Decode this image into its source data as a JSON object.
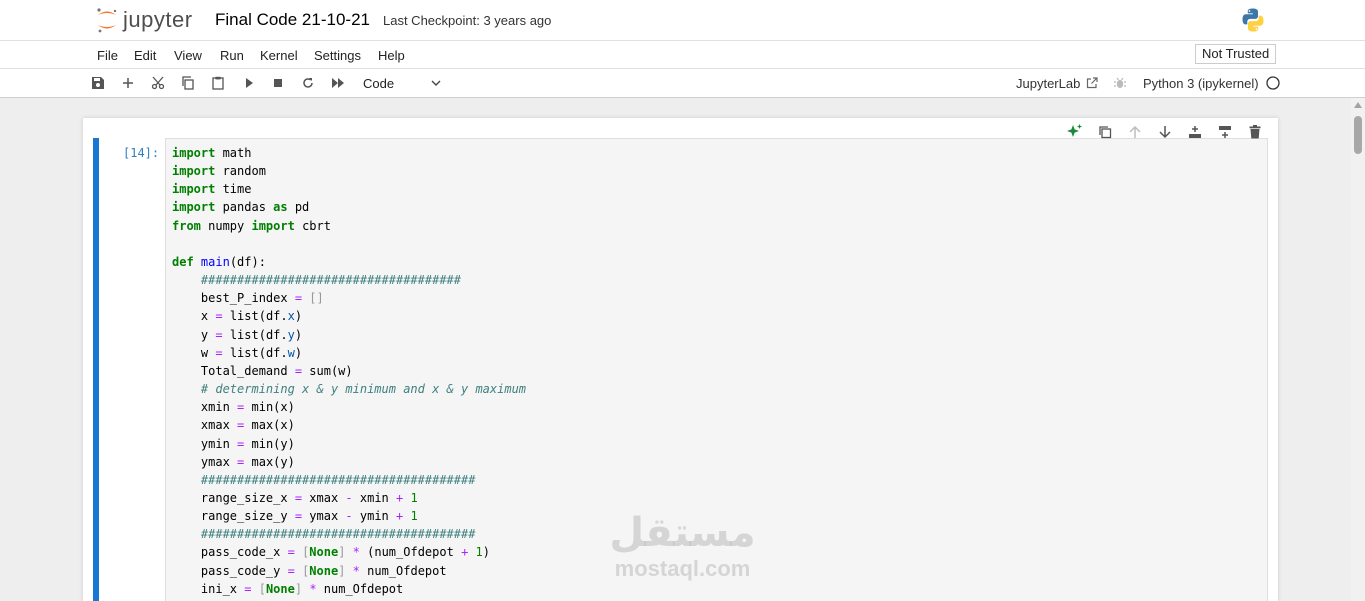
{
  "header": {
    "logo_text": "jupyter",
    "notebook_title": "Final Code 21-10-21",
    "checkpoint_text": "Last Checkpoint: 3 years ago"
  },
  "menubar": {
    "items": [
      "File",
      "Edit",
      "View",
      "Run",
      "Kernel",
      "Settings",
      "Help"
    ],
    "trusted_label": "Not Trusted"
  },
  "toolbar": {
    "icons": [
      "save-icon",
      "add-icon",
      "cut-icon",
      "copy-icon",
      "paste-icon",
      "run-icon",
      "stop-icon",
      "restart-icon",
      "fast-forward-icon"
    ],
    "cell_type": "Code",
    "jupyterlab_label": "JupyterLab",
    "kernel_name": "Python 3 (ipykernel)"
  },
  "cell": {
    "prompt": "[14]:",
    "action_icons": [
      "sparkle-icon",
      "duplicate-icon",
      "move-up-icon",
      "move-down-icon",
      "insert-above-icon",
      "insert-below-icon",
      "delete-icon"
    ],
    "code_lines": [
      "import math",
      "import random",
      "import time",
      "import pandas as pd",
      "from numpy import cbrt",
      "",
      "def main(df):",
      "    ####################################",
      "    best_P_index = []",
      "    x = list(df.x)",
      "    y = list(df.y)",
      "    w = list(df.w)",
      "    Total_demand = sum(w)",
      "    # determining x & y minimum and x & y maximum",
      "    xmin = min(x)",
      "    xmax = max(x)",
      "    ymin = min(y)",
      "    ymax = max(y)",
      "    ######################################",
      "    range_size_x = xmax - xmin + 1",
      "    range_size_y = ymax - ymin + 1",
      "    ######################################",
      "    pass_code_x = [None] * (num_Ofdepot + 1)",
      "    pass_code_y = [None] * num_Ofdepot",
      "    ini_x = [None] * num_Ofdepot"
    ]
  },
  "watermark": {
    "arabic": "مستقل",
    "latin": "mostaql.com"
  },
  "colors": {
    "cell_bar": "#1976d2",
    "prompt": "#307fc1",
    "keyword": "#008000",
    "function": "#0000ff",
    "comment": "#408080",
    "operator": "#aa22ff"
  }
}
